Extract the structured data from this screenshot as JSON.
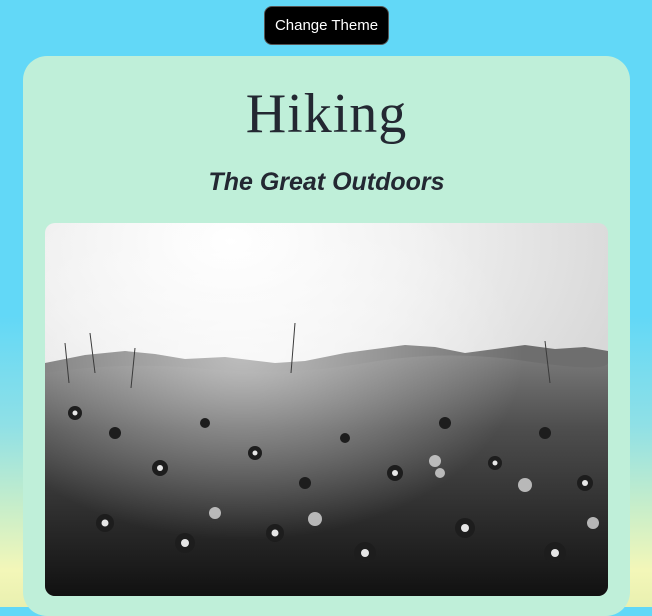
{
  "header": {
    "theme_button_label": "Change Theme"
  },
  "card": {
    "title": "Hiking",
    "subtitle": "The Great Outdoors",
    "photo_alt": "Black and white field of wildflowers with hills on the horizon"
  }
}
